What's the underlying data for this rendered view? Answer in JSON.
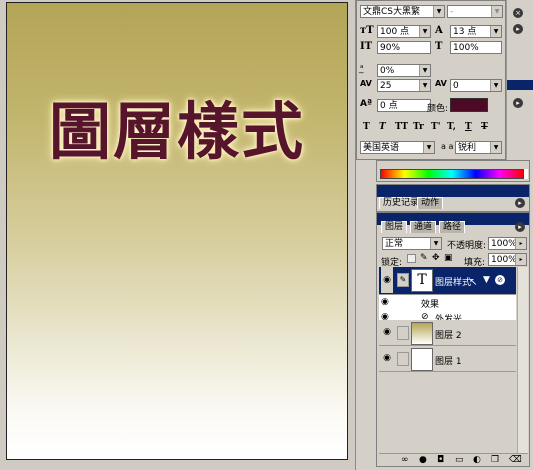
{
  "canvas": {
    "headline": "圖層樣式",
    "text_color": "#57152c",
    "glow_color": "#fff2c0",
    "gradient_top": "#b3a556",
    "gradient_bottom": "#ffffff"
  },
  "character_panel": {
    "font_family": "文鼎CS大黑繁",
    "font_style": "-",
    "font_size": "100 点",
    "leading": "13 点",
    "vertical_scale": "90%",
    "horizontal_scale": "100%",
    "tracking_ratio": "0%",
    "kerning": "25",
    "tracking": "0",
    "baseline_shift": "0 点",
    "color_label": "颜色:",
    "color_value": "#4d0a24",
    "style_buttons": [
      "T",
      "T",
      "TT",
      "Tr",
      "T'",
      "T,",
      "T",
      "T"
    ],
    "language": "美国英语",
    "aa_label": "a a",
    "antialias": "锐利"
  },
  "history_panel": {
    "tabs": [
      "历史记录",
      "动作"
    ]
  },
  "layers_panel": {
    "tabs": [
      "图层",
      "通道",
      "路径"
    ],
    "blend_mode": "正常",
    "opacity_label": "不透明度:",
    "opacity": "100%",
    "lock_label": "锁定:",
    "fill_label": "填充:",
    "fill": "100%",
    "layers": [
      {
        "name": "图层样式",
        "type": "text",
        "thumb": "T",
        "selected": true
      },
      {
        "name": "图层 2",
        "type": "gradient",
        "selected": false
      },
      {
        "name": "图层 1",
        "type": "fill",
        "selected": false
      }
    ],
    "effects_label": "效果",
    "effect_item": "外发光",
    "bottom_icons": [
      "link-icon",
      "style-icon",
      "mask-icon",
      "set-icon",
      "adjustment-icon",
      "new-layer-icon",
      "trash-icon"
    ]
  }
}
